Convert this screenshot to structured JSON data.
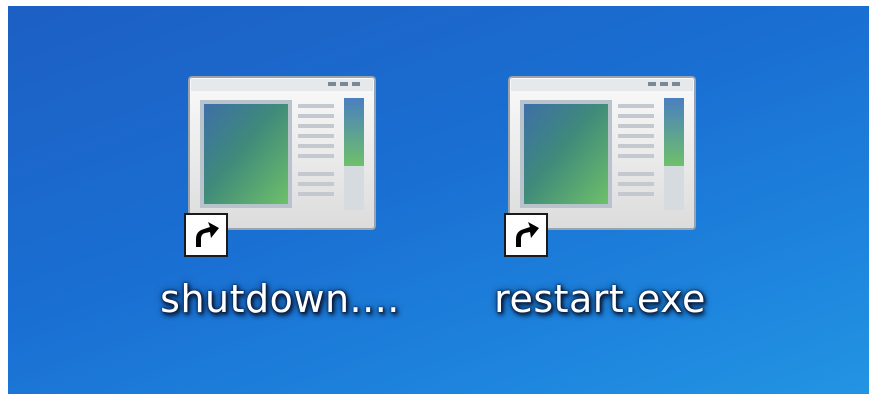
{
  "desktop": {
    "icons": [
      {
        "label": "shutdown....",
        "icon": "application-window-icon",
        "overlay": "shortcut-arrow-icon"
      },
      {
        "label": "restart.exe",
        "icon": "application-window-icon",
        "overlay": "shortcut-arrow-icon"
      }
    ]
  },
  "colors": {
    "desktop_background": "#1a6fd2",
    "label_text": "#ffffff"
  }
}
